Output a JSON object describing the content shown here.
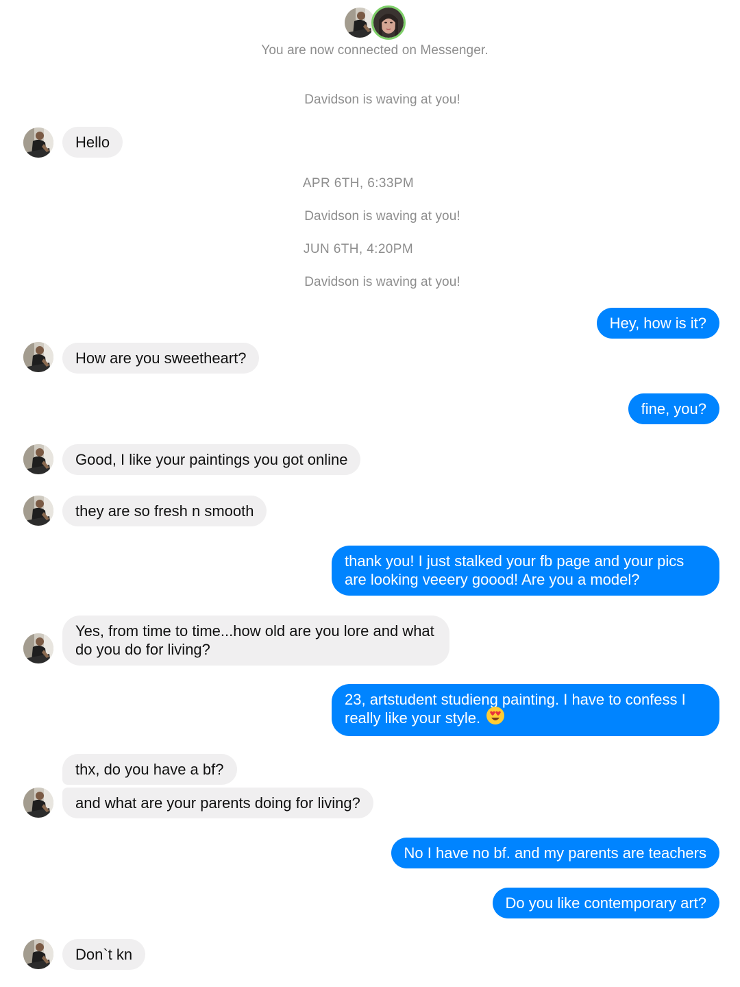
{
  "header": {
    "connected_text": "You are now connected on Messenger."
  },
  "colors": {
    "outgoing_bubble": "#0084ff",
    "incoming_bubble": "#f0eff0",
    "system_text": "#8d8d8d",
    "active_ring": "#7ed069"
  },
  "events": {
    "wave_1": "Davidson is waving at you!",
    "time_1": "APR 6TH, 6:33PM",
    "wave_2": "Davidson is waving at you!",
    "time_2": "JUN 6TH, 4:20PM",
    "wave_3": "Davidson is waving at you!"
  },
  "messages": {
    "m1": "Hello",
    "m2": "Hey, how is it?",
    "m3": "How are you sweetheart?",
    "m4": "fine, you?",
    "m5": "Good, I like your paintings you got online",
    "m6": "they are so fresh n smooth",
    "m7": "thank you! I just stalked your fb page and your pics are looking veeery goood! Are you a model?",
    "m8": "Yes, from time to time...how old are you lore and what do you do for living?",
    "m9": "23, artstudent studieng painting. I have to confess I really like your style.",
    "m10": "thx, do you have a bf?",
    "m11": "and what are your parents doing for living?",
    "m12": "No I have no bf. and my parents are teachers",
    "m13": "Do you like contemporary art?",
    "m14": "Don`t kn"
  },
  "icons": {
    "emoji": "smiling-face-with-heart-eyes-icon"
  }
}
